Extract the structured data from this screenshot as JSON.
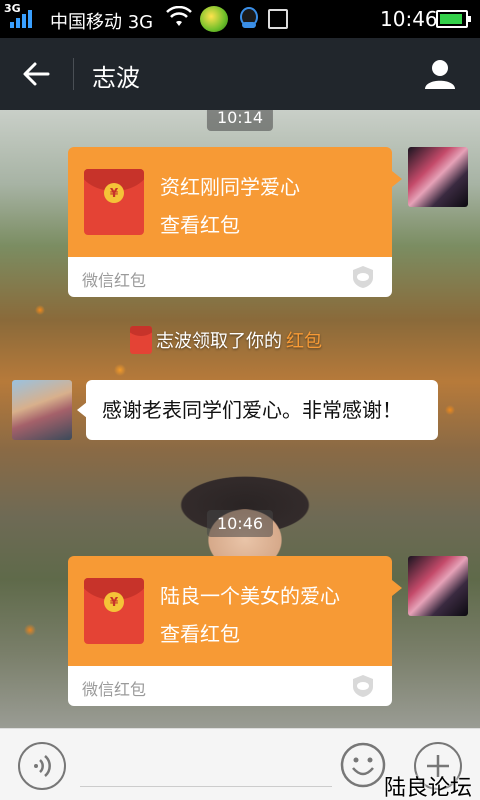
{
  "status_bar": {
    "network": "3G",
    "carrier": "中国移动 3G",
    "time": "10:46",
    "icons": [
      "signal-icon",
      "wifi-icon",
      "app-notification-icon",
      "qq-icon",
      "image-icon",
      "battery-icon"
    ]
  },
  "header": {
    "title": "志波",
    "back_icon": "back-arrow-icon",
    "profile_icon": "person-icon",
    "bg_color": "#21262c"
  },
  "chat": {
    "timestamps": [
      "10:14",
      "10:46"
    ],
    "red_packets": [
      {
        "message": "资红刚同学爱心",
        "action": "查看红包",
        "brand": "微信红包"
      },
      {
        "message": "陆良一个美女的爱心",
        "action": "查看红包",
        "brand": "微信红包"
      }
    ],
    "notice": {
      "prefix": "志波领取了你的",
      "link": "红包"
    },
    "text_message": "感谢老表同学们爱心。非常感谢！",
    "packet_color": "#f79a35",
    "packet_red": "#e44335"
  },
  "input_bar": {
    "placeholder": "",
    "icons": [
      "voice-icon",
      "emoji-icon",
      "plus-icon"
    ]
  },
  "watermark": "陆良论坛"
}
